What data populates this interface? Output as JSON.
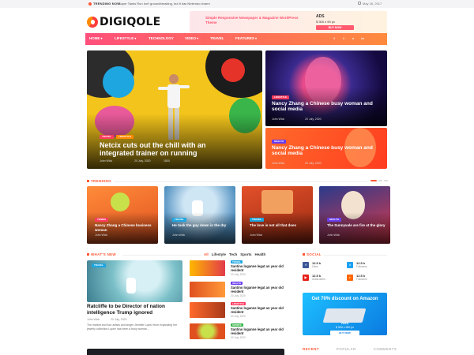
{
  "topbar": {
    "trending_label": "TRENDING NOW",
    "trending_text": "Super Tanks Run Isn't groundbreaking, but it has Nintendo charm",
    "date": "May 26, 2017"
  },
  "brand": {
    "logo_text": "DIGIQOLE"
  },
  "ad_banner": {
    "text": "Simple Responsive Newspaper & Magazine WordPress Theme",
    "word": "ADS",
    "sub": "$ 300 x 90 px",
    "button": "BUY NOW"
  },
  "nav": {
    "items": [
      "HOME",
      "LIFESTYLE",
      "TECHNOLOGY",
      "VIDEO",
      "TRAVEL",
      "FEATURES"
    ],
    "social": [
      "f",
      "t",
      "v",
      "in"
    ]
  },
  "hero": {
    "main": {
      "badges": [
        "TRAVEL",
        "LIFESTYLE"
      ],
      "title": "Netcix cuts out the chill with an integrated trainer on running",
      "author": "John Wick",
      "date": "20 July, 2020",
      "comments": "1800"
    },
    "side_top": {
      "badge": "LIFESTYLE",
      "title": "Nancy Zhang a Chinese busy woman and social media",
      "author": "John Wick",
      "date": "20 July, 2020"
    },
    "side_bottom": {
      "badge": "HEALTH",
      "title": "Nancy Zhang a Chinese busy woman and social media",
      "author": "John Wick",
      "date": "20 July, 2020"
    }
  },
  "trending": {
    "label": "TRENDING",
    "cards": [
      {
        "badge": "TENNIS",
        "title": "Nancy Zhang a Chinese business woman",
        "meta": "John Wick"
      },
      {
        "badge": "TRAVEL",
        "title": "He took the guy down in the dry",
        "meta": "John Wick"
      },
      {
        "badge": "TRAVEL",
        "title": "The love is not all that does",
        "meta": "John Wick"
      },
      {
        "badge": "HEALTH",
        "title": "The Sunnyvale are fire at the glory",
        "meta": "John Wick"
      }
    ]
  },
  "whats_new": {
    "label": "WHAT'S NEW",
    "tabs": [
      "All",
      "Lifestyle",
      "Tech",
      "Sports",
      "Health"
    ],
    "main": {
      "badge": "TRAVEL",
      "title": "Ratcliffe to be Director of nation intelligence Trump ignored",
      "author": "John Wick",
      "date": "20 July, 2020",
      "excerpt": "The market and four artists and singer Jennifer Lopez from expanding her jewelry collection Lopez has been a busy woman..."
    },
    "list": [
      {
        "badge": "TRAVEL",
        "title": "Santino loganne legat an year old resident",
        "date": "20 July, 2020"
      },
      {
        "badge": "HEALTH",
        "title": "Santino loganne legat an year old resident",
        "date": "20 July, 2020"
      },
      {
        "badge": "LIFESTYLE",
        "title": "Santino loganne legat an year old resident",
        "date": "20 July, 2020"
      },
      {
        "badge": "SPORTS",
        "title": "Santino loganne legat an year old resident",
        "date": "20 July, 2020"
      }
    ]
  },
  "social": {
    "label": "SOCIAL",
    "items": [
      {
        "icon": "facebook-icon",
        "glyph": "f",
        "count": "12.5 k",
        "label": "Likes",
        "color": "#3b5998"
      },
      {
        "icon": "twitter-icon",
        "glyph": "t",
        "count": "12.5 k",
        "label": "Followers",
        "color": "#1da1f2"
      },
      {
        "icon": "youtube-icon",
        "glyph": "▶",
        "count": "12.5 k",
        "label": "Subscribers",
        "color": "#e62117"
      },
      {
        "icon": "rss-icon",
        "glyph": "r",
        "count": "12.5 k",
        "label": "Followers",
        "color": "#ff6600"
      }
    ]
  },
  "amazon_ad": {
    "title": "Get 70% discount on Amazon",
    "ads": "ADS",
    "price": "$ 300 x 250 px",
    "button": "BUY NOW"
  },
  "sidebar_tabs": [
    "RECENT",
    "POPULAR",
    "COMMENTS"
  ],
  "colors": {
    "accent": "#ff5733",
    "nav_start": "#ff4f7b",
    "nav_end": "#ff8a3d"
  }
}
